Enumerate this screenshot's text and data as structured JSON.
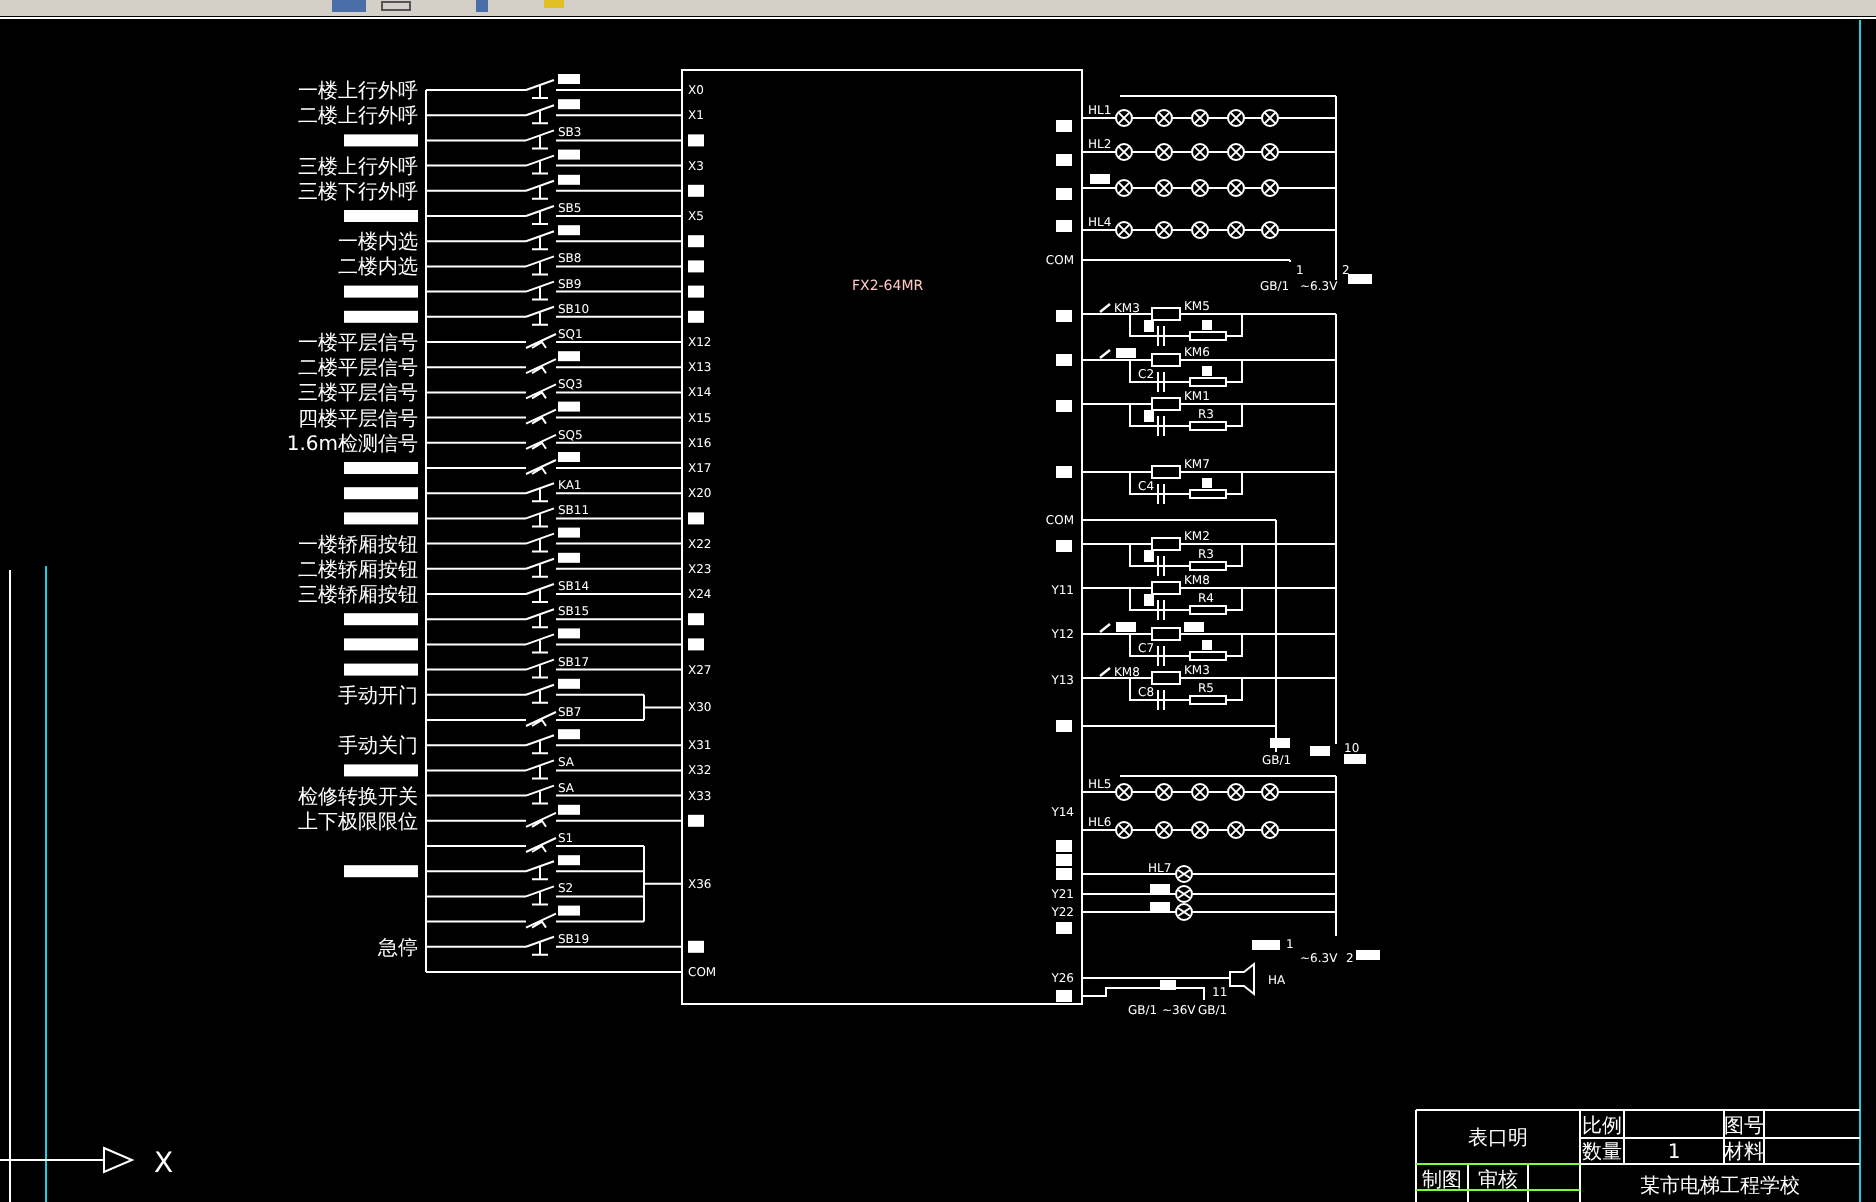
{
  "plc": {
    "model": "FX2-64MR"
  },
  "inputs": [
    {
      "kind": "button",
      "label": "一楼上行外呼",
      "label_masked": false,
      "tag_masked": true,
      "address": "X0",
      "address_masked": false
    },
    {
      "kind": "button",
      "label": "二楼上行外呼",
      "label_masked": false,
      "tag_masked": true,
      "address": "X1",
      "address_masked": false
    },
    {
      "kind": "button",
      "label_masked": true,
      "tag": "SB3",
      "tag_masked": false,
      "address_masked": true
    },
    {
      "kind": "button",
      "label": "三楼上行外呼",
      "label_masked": false,
      "tag_masked": true,
      "address": "X3",
      "address_masked": false
    },
    {
      "kind": "button",
      "label": "三楼下行外呼",
      "label_masked": false,
      "tag_masked": true,
      "address_masked": true
    },
    {
      "kind": "button",
      "label_masked": true,
      "tag": "SB5",
      "tag_masked": false,
      "address": "X5",
      "address_masked": false
    },
    {
      "kind": "button",
      "label": "一楼内选",
      "label_masked": false,
      "tag_masked": true,
      "address_masked": true
    },
    {
      "kind": "button",
      "label": "二楼内选",
      "label_masked": false,
      "tag": "SB8",
      "tag_masked": false,
      "address_masked": true
    },
    {
      "kind": "button",
      "label_masked": true,
      "tag": "SB9",
      "tag_masked": false,
      "address_masked": true
    },
    {
      "kind": "button",
      "label_masked": true,
      "tag": "SB10",
      "tag_masked": false,
      "address_masked": true
    },
    {
      "kind": "limit",
      "label": "一楼平层信号",
      "label_masked": false,
      "tag": "SQ1",
      "tag_masked": false,
      "address": "X12",
      "address_masked": false
    },
    {
      "kind": "limit",
      "label": "二楼平层信号",
      "label_masked": false,
      "tag_masked": true,
      "address": "X13",
      "address_masked": false
    },
    {
      "kind": "limit",
      "label": "三楼平层信号",
      "label_masked": false,
      "tag": "SQ3",
      "tag_masked": false,
      "address": "X14",
      "address_masked": false
    },
    {
      "kind": "limit",
      "label": "四楼平层信号",
      "label_masked": false,
      "tag_masked": true,
      "address": "X15",
      "address_masked": false
    },
    {
      "kind": "limit",
      "label": "1.6m检测信号",
      "label_masked": false,
      "tag": "SQ5",
      "tag_masked": false,
      "address": "X16",
      "address_masked": false
    },
    {
      "kind": "limit",
      "label_masked": true,
      "tag_masked": true,
      "address": "X17",
      "address_masked": false
    },
    {
      "kind": "button",
      "label_masked": true,
      "tag": "KA1",
      "tag_masked": false,
      "address": "X20",
      "address_masked": false
    },
    {
      "kind": "button",
      "label_masked": true,
      "tag": "SB11",
      "tag_masked": false,
      "address_masked": true
    },
    {
      "kind": "button",
      "label": "一楼轿厢按钮",
      "label_masked": false,
      "tag_masked": true,
      "address": "X22",
      "address_masked": false
    },
    {
      "kind": "button",
      "label": "二楼轿厢按钮",
      "label_masked": false,
      "tag_masked": true,
      "address": "X23",
      "address_masked": false
    },
    {
      "kind": "button",
      "label": "三楼轿厢按钮",
      "label_masked": false,
      "tag": "SB14",
      "tag_masked": false,
      "address": "X24",
      "address_masked": false
    },
    {
      "kind": "button",
      "label_masked": true,
      "tag": "SB15",
      "tag_masked": false,
      "address_masked": true
    },
    {
      "kind": "button",
      "label_masked": true,
      "tag_masked": true,
      "address_masked": true
    },
    {
      "kind": "button",
      "label_masked": true,
      "tag": "SB17",
      "tag_masked": false,
      "address": "X27",
      "address_masked": false
    },
    {
      "kind": "group",
      "address": "X30",
      "address_masked": false,
      "rows": [
        {
          "kind": "button",
          "label": "手动开门",
          "label_masked": false,
          "tag_masked": true
        },
        {
          "kind": "limit",
          "label_masked": false,
          "tag": "SB7",
          "tag_masked": false
        }
      ]
    },
    {
      "kind": "button",
      "label": "手动关门",
      "label_masked": false,
      "tag_masked": true,
      "address": "X31",
      "address_masked": false
    },
    {
      "kind": "button",
      "label_masked": true,
      "tag": "SA",
      "tag_masked": false,
      "address": "X32",
      "address_masked": false
    },
    {
      "kind": "button",
      "label": "检修转换开关",
      "label_masked": false,
      "tag": "SA",
      "tag_masked": false,
      "address": "X33",
      "address_masked": false
    },
    {
      "kind": "limit",
      "label": "上下极限限位",
      "label_masked": false,
      "tag_masked": true,
      "address_masked": true
    },
    {
      "kind": "group",
      "address": "X36",
      "address_masked": false,
      "rows": [
        {
          "kind": "limit",
          "label_masked": false,
          "tag": "S1",
          "tag_masked": false
        },
        {
          "kind": "button",
          "label_masked": true,
          "tag_masked": true
        },
        {
          "kind": "button",
          "label_masked": false,
          "tag": "S2",
          "tag_masked": false
        },
        {
          "kind": "limit",
          "label_masked": false,
          "tag_masked": true
        }
      ]
    },
    {
      "kind": "button",
      "label": "急停",
      "label_masked": false,
      "tag": "SB19",
      "tag_masked": false,
      "address_masked": true
    }
  ],
  "input_common": {
    "address": "COM"
  },
  "outputs": [
    {
      "address_masked": true
    },
    {
      "address_masked": true
    },
    {
      "address_masked": true
    },
    {
      "address_masked": true
    },
    {
      "address": "COM",
      "address_masked": false
    },
    {
      "address_masked": true
    },
    {
      "address_masked": true
    },
    {
      "address_masked": true
    },
    {
      "address_masked": true
    },
    {
      "address": "COM",
      "address_masked": false
    },
    {
      "address_masked": true
    },
    {
      "address": "Y11",
      "address_masked": false
    },
    {
      "address": "Y12",
      "address_masked": false
    },
    {
      "address": "Y13",
      "address_masked": false
    },
    {
      "address_masked": true
    },
    {
      "address": "Y14",
      "address_masked": false
    },
    {
      "address_masked": true
    },
    {
      "address_masked": true
    },
    {
      "address_masked": true
    },
    {
      "address": "Y21",
      "address_masked": false
    },
    {
      "address": "Y22",
      "address_masked": false
    },
    {
      "address_masked": true
    },
    {
      "address": "Y26",
      "address_masked": false
    },
    {
      "address_masked": true
    }
  ],
  "lamp_groups": [
    {
      "label": "HL1",
      "label_masked": false
    },
    {
      "label": "HL2",
      "label_masked": false
    },
    {
      "label_masked": true
    },
    {
      "label": "HL4",
      "label_masked": false
    },
    {
      "label": "HL5",
      "label_masked": false
    },
    {
      "label": "HL6",
      "label_masked": false
    }
  ],
  "indicator_lamps": [
    {
      "label": "HL7",
      "label_masked": false
    },
    {
      "label_masked": true
    },
    {
      "label_masked": true
    }
  ],
  "coil_rows": [
    {
      "left_tag": "KM3",
      "left_masked": false,
      "coil_tag": "KM5",
      "coil_masked": false,
      "contact_masked": true,
      "resistor_masked": true
    },
    {
      "left_masked": true,
      "coil_tag": "KM6",
      "coil_masked": false,
      "contact_tag": "C2",
      "contact_masked": false,
      "resistor_masked": true
    },
    {
      "left_masked": false,
      "coil_tag": "KM1",
      "coil_masked": false,
      "contact_masked": true,
      "resistor_tag": "R3",
      "resistor_masked": false
    },
    {
      "left_masked": false,
      "coil_tag": "KM7",
      "coil_masked": false,
      "contact_tag": "C4",
      "contact_masked": false,
      "resistor_masked": true
    },
    {
      "left_masked": false,
      "coil_tag": "KM2",
      "coil_masked": false,
      "contact_masked": true,
      "resistor_tag": "R3",
      "resistor_masked": false
    },
    {
      "left_masked": false,
      "coil_tag": "KM8",
      "coil_masked": false,
      "contact_masked": true,
      "resistor_tag": "R4",
      "resistor_masked": false
    },
    {
      "left_masked": true,
      "coil_masked": true,
      "contact_tag": "C7",
      "contact_masked": false,
      "resistor_masked": true
    },
    {
      "left_tag": "KM8",
      "left_masked": false,
      "coil_tag": "KM3",
      "coil_masked": false,
      "contact_tag": "C8",
      "contact_masked": false,
      "resistor_tag": "R5",
      "resistor_masked": false
    }
  ],
  "notes": [
    {
      "text": "1",
      "masked": false
    },
    {
      "text": "2",
      "masked": false
    },
    {
      "text": "GB/1",
      "masked": false
    },
    {
      "text": "~6.3V",
      "masked": false
    },
    {
      "masked": true
    },
    {
      "masked": true
    },
    {
      "text": "GB/1",
      "masked": false
    },
    {
      "masked": true
    },
    {
      "text": "10",
      "masked": false
    },
    {
      "masked": true
    },
    {
      "masked": true
    },
    {
      "text": "1",
      "masked": false
    },
    {
      "text": "~6.3V",
      "masked": false
    },
    {
      "text": "2",
      "masked": false
    },
    {
      "masked": true
    },
    {
      "text": "HA",
      "masked": false
    },
    {
      "masked": true
    },
    {
      "text": "11",
      "masked": false
    },
    {
      "text": "GB/1",
      "masked": false
    },
    {
      "text": "~36V",
      "masked": false
    },
    {
      "text": "GB/1",
      "masked": false
    }
  ],
  "title_block": {
    "drawing_name": "表口明",
    "scale_label": "比例",
    "number_label": "图号",
    "quantity_label": "数量",
    "quantity": "1",
    "material_label": "材料",
    "drawn_by_label": "制图",
    "checked_by_label": "审核",
    "school": "某市电梯工程学校"
  },
  "ucs": {
    "axis_label": "X"
  }
}
